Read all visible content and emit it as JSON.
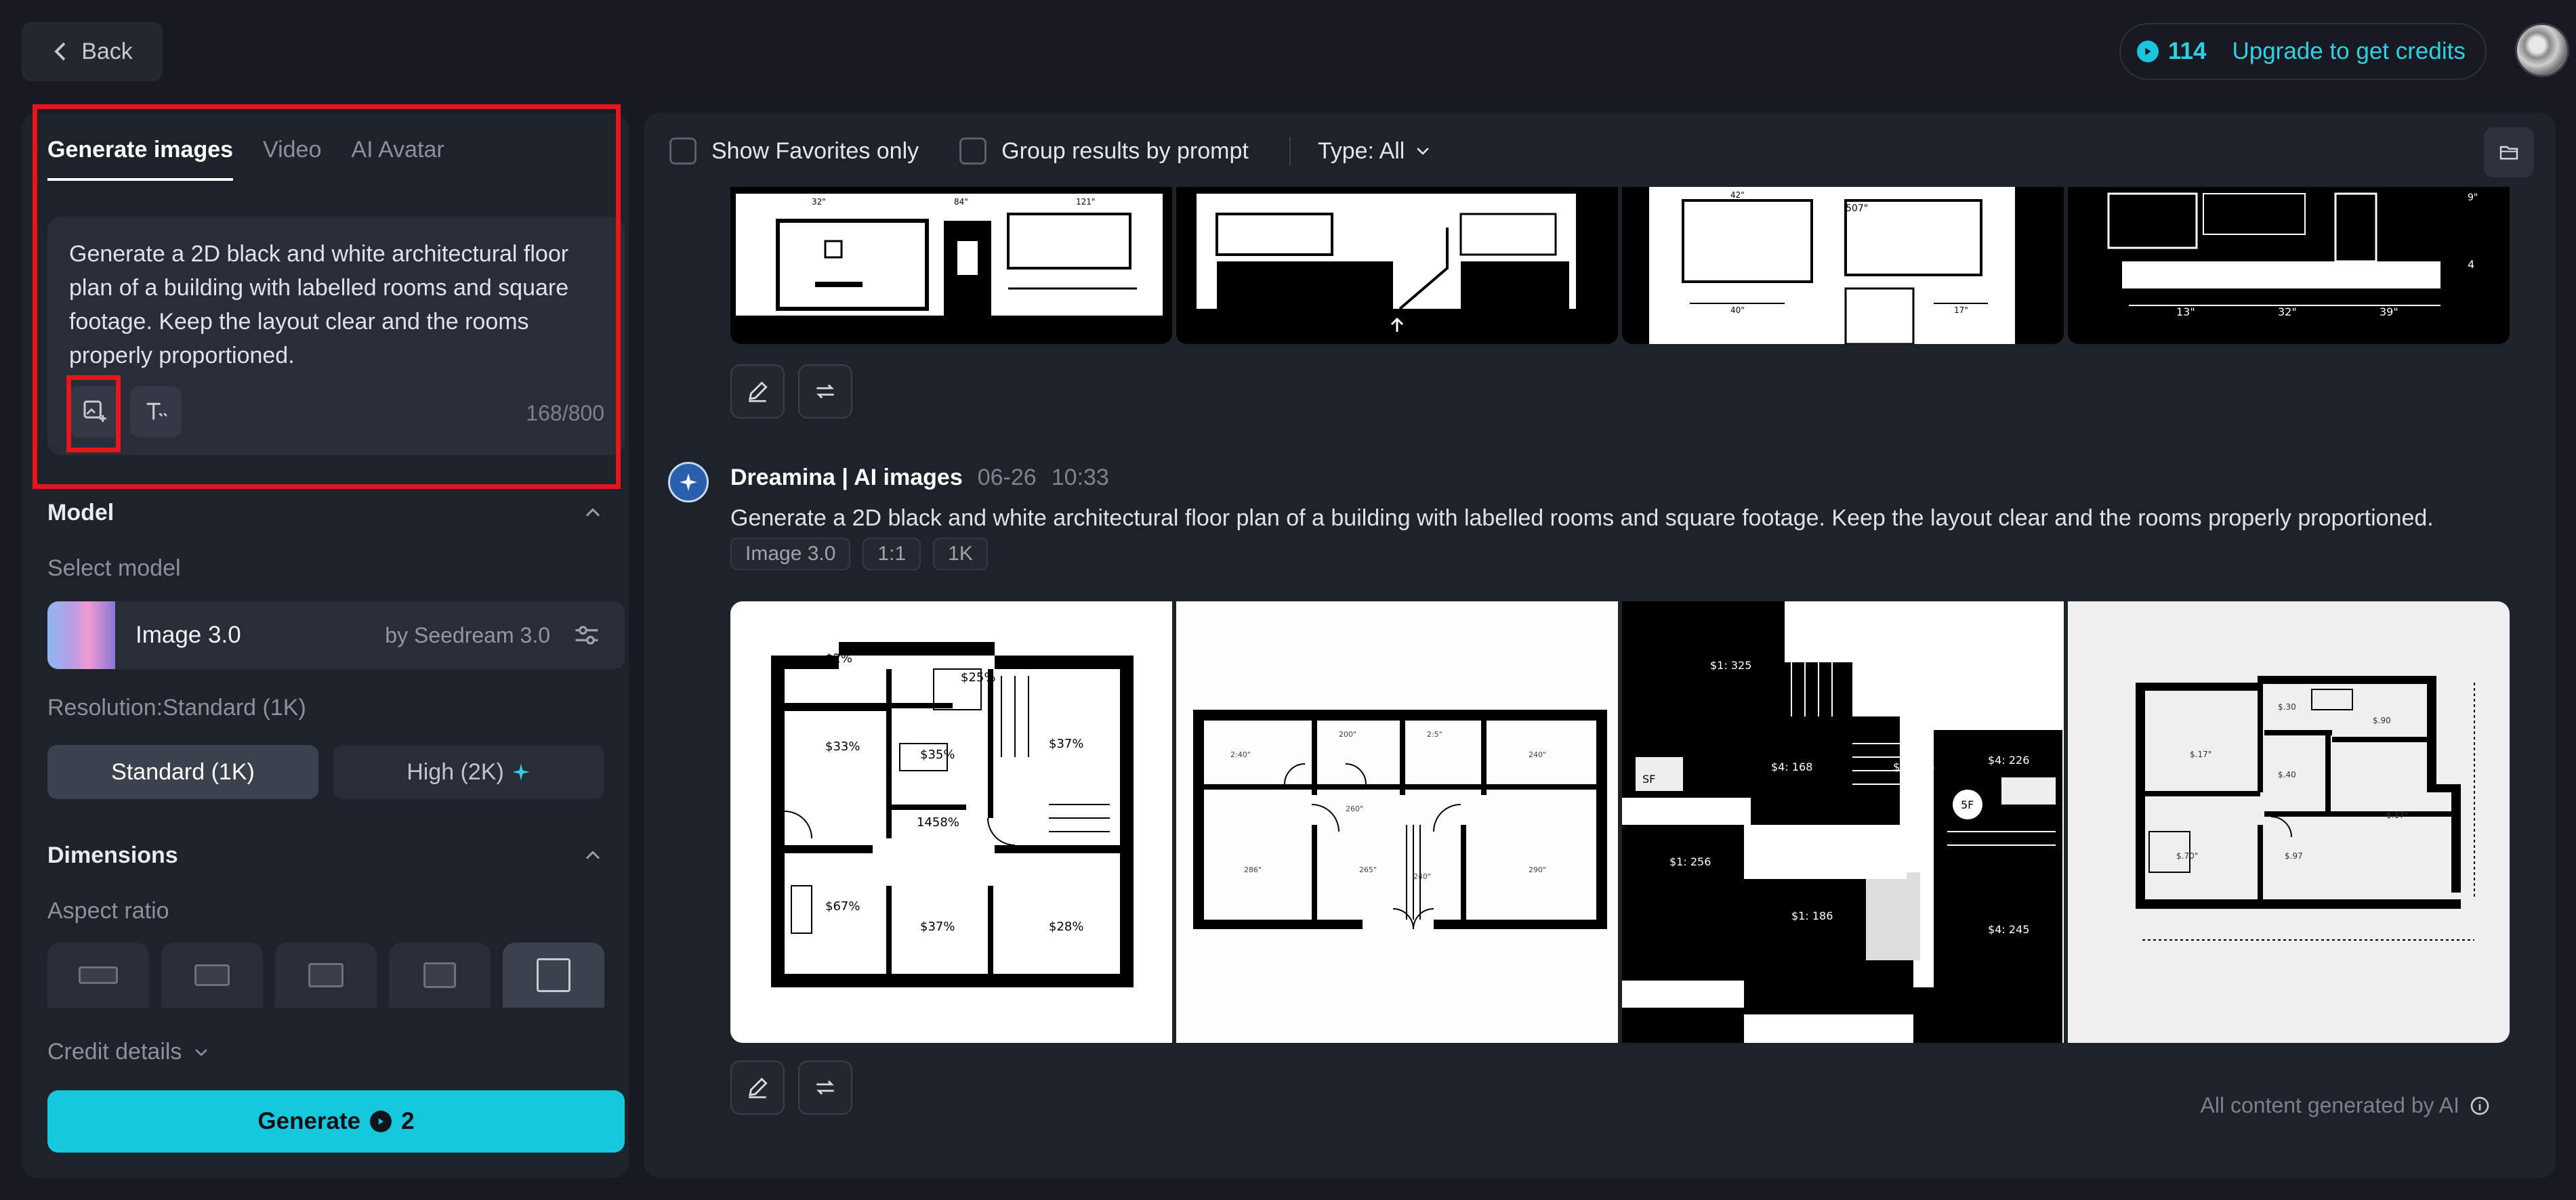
{
  "header": {
    "back_label": "Back",
    "credits_count": "114",
    "upgrade_label": "Upgrade to get credits"
  },
  "left_panel": {
    "tabs": [
      {
        "label": "Generate images",
        "active": true
      },
      {
        "label": "Video",
        "active": false
      },
      {
        "label": "AI Avatar",
        "active": false
      }
    ],
    "prompt_text": "Generate a 2D black and white architectural floor plan of a building with labelled rooms and square footage. Keep the layout clear and the rooms properly proportioned.",
    "char_count": "168/800",
    "model_section_title": "Model",
    "select_model_label": "Select model",
    "model_name": "Image 3.0",
    "model_by": "by Seedream 3.0",
    "resolution_label": "Resolution:Standard (1K)",
    "resolution_options": [
      "Standard (1K)",
      "High (2K)"
    ],
    "selected_resolution": "Standard (1K)",
    "dimensions_section_title": "Dimensions",
    "aspect_ratio_label": "Aspect ratio",
    "credit_details_label": "Credit details",
    "generate_label": "Generate",
    "generate_cost": "2"
  },
  "right_panel": {
    "show_favorites_label": "Show Favorites only",
    "group_results_label": "Group results by prompt",
    "type_filter_label": "Type: All",
    "generation": {
      "source": "Dreamina | AI images",
      "date": "06-26",
      "time": "10:33",
      "prompt": "Generate a 2D black and white architectural floor plan of a building with labelled rooms and square footage. Keep the layout clear and the rooms properly proportioned.",
      "tags": [
        "Image 3.0",
        "1:1",
        "1K"
      ],
      "image_labels": [
        [
          "$33%",
          "$35%",
          "$37%",
          "1458%",
          "$67%",
          "$37%",
          "$28%",
          "25%",
          "2%"
        ],
        [
          "2:40\"",
          "200\"",
          "2:5\"",
          "240\"",
          "260\"",
          "240\"",
          "290\"",
          "265\"",
          "286\""
        ],
        [
          "$1: 325",
          "$4: 168",
          "$4: 226",
          "$4: 226",
          "$1: 256",
          "$1: 186",
          "$4: 245",
          "SF",
          "5F"
        ],
        [
          "$.17\"",
          "$.30",
          "$.90",
          "$.40",
          "$.17\"",
          "$.70\"",
          "$.97"
        ]
      ]
    },
    "top_image_dims": [
      "13\"",
      "32\"",
      "39\"",
      "40\"",
      "17\"",
      "507\"",
      "42\"",
      "9\""
    ],
    "footnote": "All content generated by AI"
  },
  "colors": {
    "accent": "#16c8de",
    "highlight": "#e6161c",
    "background": "#171a21",
    "panel": "#1e222a"
  },
  "icons": [
    "chevron-left-icon",
    "coin-icon",
    "image-upload-icon",
    "text-style-icon",
    "chevron-up-icon",
    "settings-sliders-icon",
    "sparkle-icon",
    "chevron-down-icon",
    "folder-icon",
    "edit-icon",
    "regenerate-icon",
    "dreamina-logo-icon",
    "info-icon"
  ]
}
